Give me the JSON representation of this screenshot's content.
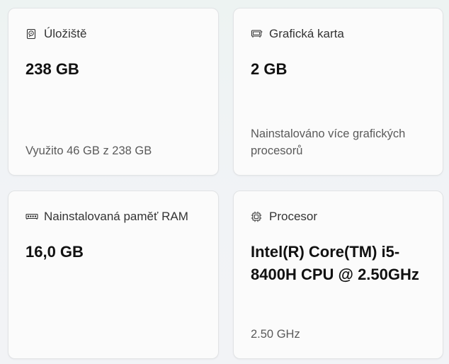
{
  "cards": {
    "storage": {
      "icon": "hard-drive-icon",
      "title": "Úložiště",
      "value": "238 GB",
      "subtext": "Využito 46 GB z 238 GB"
    },
    "gpu": {
      "icon": "graphics-card-icon",
      "title": "Grafická karta",
      "value": "2 GB",
      "subtext": "Nainstalováno více grafických procesorů"
    },
    "ram": {
      "icon": "memory-icon",
      "title": "Nainstalovaná paměť RAM",
      "value": "16,0 GB"
    },
    "cpu": {
      "icon": "processor-icon",
      "title": "Procesor",
      "value": "Intel(R) Core(TM) i5-8400H CPU @ 2.50GHz",
      "subtext": "2.50 GHz"
    }
  },
  "colors": {
    "background": "#eef3f2",
    "card": "#fbfbfb",
    "border": "#e1e3e5",
    "subtext": "#5a5a5a"
  }
}
